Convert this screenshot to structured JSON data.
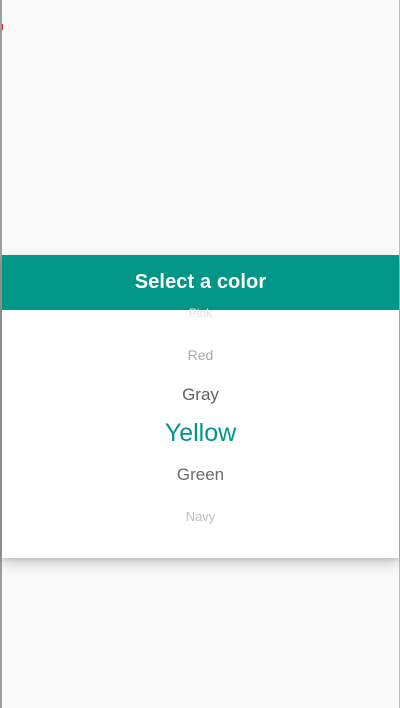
{
  "dialog": {
    "title": "Select a color",
    "selected": "Yellow",
    "options": [
      "Pink",
      "Red",
      "Gray",
      "Yellow",
      "Green",
      "Navy"
    ]
  },
  "colors": {
    "accent": "#009688",
    "background": "#fafafa",
    "dialog_background": "#ffffff"
  }
}
